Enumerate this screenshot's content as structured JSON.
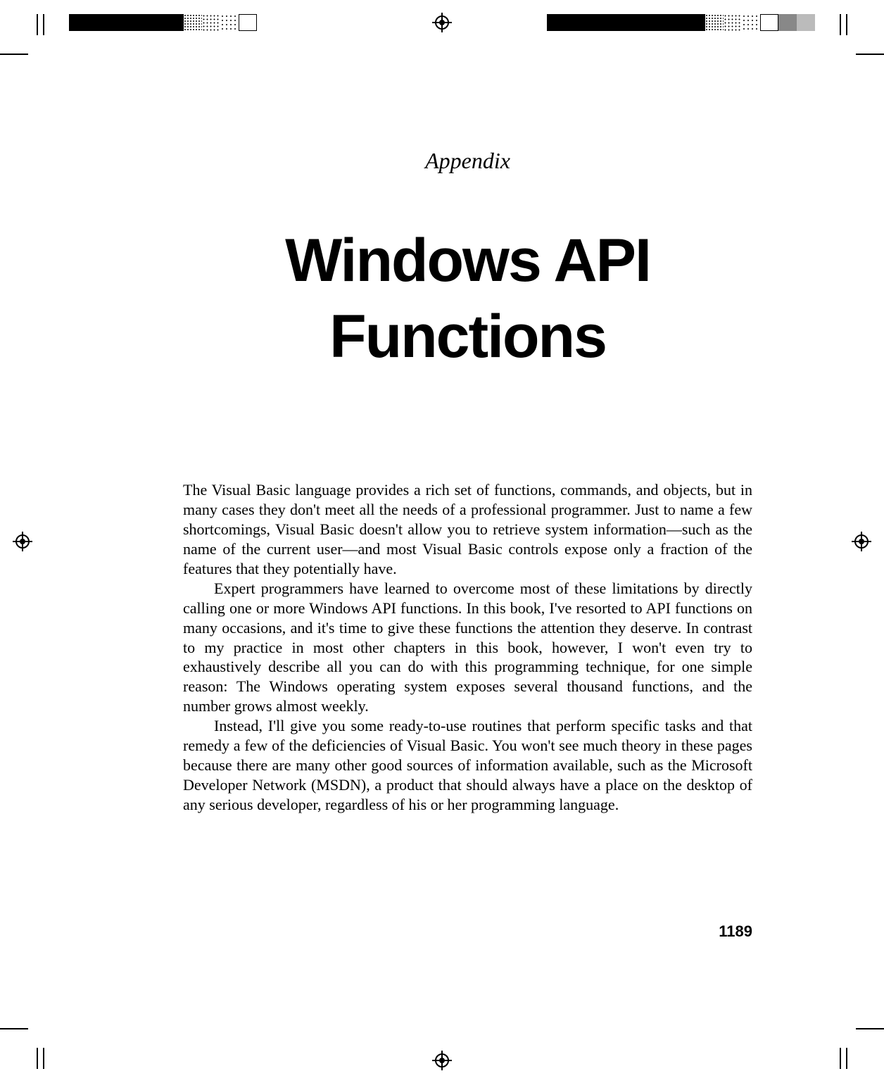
{
  "overtitle": "Appendix",
  "title_line1": "Windows API",
  "title_line2": "Functions",
  "para1": "The Visual Basic language provides a rich set of functions, commands, and objects, but in many cases they don't meet all the needs of a professional programmer. Just to name a few shortcomings, Visual Basic doesn't allow you to retrieve system information—such as the name of the current user—and most Visual Basic controls expose only a fraction of the features that they potentially have.",
  "para2": "Expert programmers have learned to overcome most of these limitations by directly calling one or more Windows API functions. In this book, I've resorted to API functions on many occasions, and it's time to give these functions the attention they deserve. In contrast to my practice in most other chapters in this book, however, I won't even try to exhaustively describe all you can do with this programming technique, for one simple reason: The Windows operating system exposes several thousand functions, and the number grows almost weekly.",
  "para3": "Instead, I'll give you some ready-to-use routines that perform specific tasks and that remedy a few of the deficiencies of Visual Basic. You won't see much theory in these pages because there are many other good sources of information available, such as the Microsoft Developer Network (MSDN), a product that should always have a place on the desktop of any serious developer, regardless of his or her programming language.",
  "page_number": "1189"
}
